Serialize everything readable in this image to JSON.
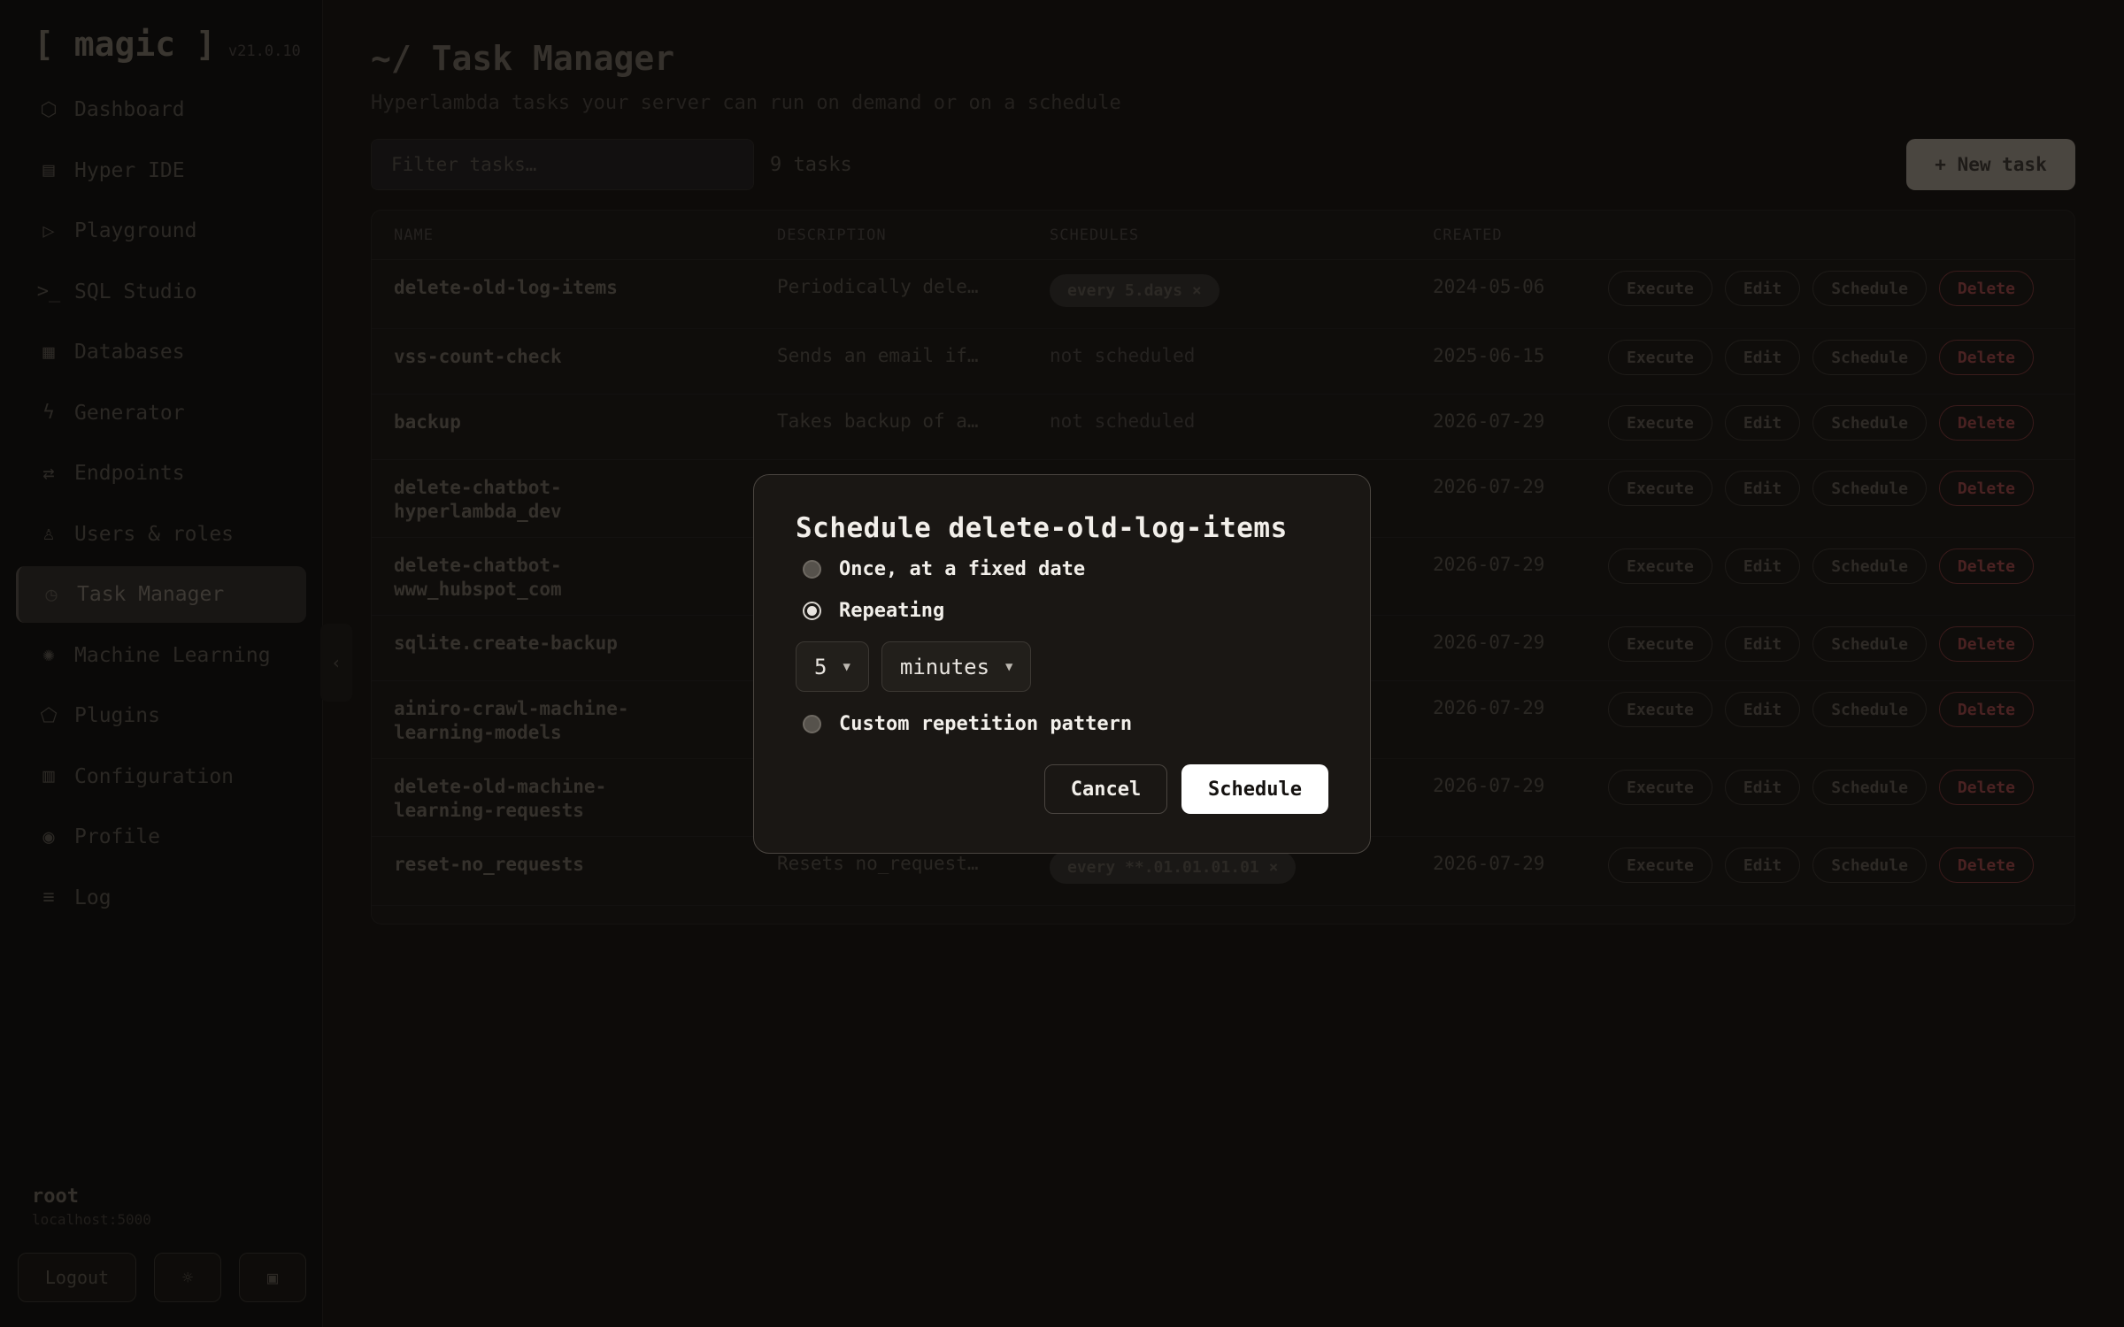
{
  "brand": {
    "logo": "[ magic ]",
    "version": "v21.0.10"
  },
  "nav": [
    {
      "label": "Dashboard",
      "icon": "dashboard-icon",
      "glyph": "⬡"
    },
    {
      "label": "Hyper IDE",
      "icon": "file-icon",
      "glyph": "▤"
    },
    {
      "label": "Playground",
      "icon": "play-icon",
      "glyph": "▷"
    },
    {
      "label": "SQL Studio",
      "icon": "terminal-icon",
      "glyph": ">_"
    },
    {
      "label": "Databases",
      "icon": "database-icon",
      "glyph": "▦"
    },
    {
      "label": "Generator",
      "icon": "bolt-icon",
      "glyph": "ϟ"
    },
    {
      "label": "Endpoints",
      "icon": "endpoints-icon",
      "glyph": "⇄"
    },
    {
      "label": "Users & roles",
      "icon": "user-icon",
      "glyph": "♙"
    },
    {
      "label": "Task Manager",
      "icon": "clock-icon",
      "glyph": "◷",
      "active": true
    },
    {
      "label": "Machine Learning",
      "icon": "brain-icon",
      "glyph": "✺"
    },
    {
      "label": "Plugins",
      "icon": "plugin-icon",
      "glyph": "⬠"
    },
    {
      "label": "Configuration",
      "icon": "config-icon",
      "glyph": "▥"
    },
    {
      "label": "Profile",
      "icon": "profile-icon",
      "glyph": "◉"
    },
    {
      "label": "Log",
      "icon": "log-icon",
      "glyph": "≡"
    }
  ],
  "user": {
    "name": "root",
    "host": "localhost:5000"
  },
  "footer": {
    "logout": "Logout",
    "theme_glyph": "☼",
    "settings_glyph": "▣"
  },
  "page": {
    "title": "~/ Task Manager",
    "subtitle": "Hyperlambda tasks your server can run on demand or on a schedule",
    "filter_placeholder": "Filter tasks…",
    "task_count": "9 tasks",
    "new_task": "+ New task"
  },
  "table": {
    "headers": {
      "name": "NAME",
      "description": "DESCRIPTION",
      "schedules": "SCHEDULES",
      "created": "CREATED"
    },
    "actions": {
      "execute": "Execute",
      "edit": "Edit",
      "schedule": "Schedule",
      "delete": "Delete"
    },
    "rows": [
      {
        "name": "delete-old-log-items",
        "description": "Periodically dele…",
        "schedule": "every 5.days ×",
        "scheduled": true,
        "created": "2024-05-06"
      },
      {
        "name": "vss-count-check",
        "description": "Sends an email if…",
        "schedule": "not scheduled",
        "scheduled": false,
        "created": "2025-06-15"
      },
      {
        "name": "backup",
        "description": "Takes backup of a…",
        "schedule": "not scheduled",
        "scheduled": false,
        "created": "2026-07-29"
      },
      {
        "name": "delete-chatbot-hyperlambda_dev",
        "description": "",
        "schedule": "",
        "scheduled": false,
        "created": "2026-07-29"
      },
      {
        "name": "delete-chatbot-www_hubspot_com",
        "description": "",
        "schedule": "",
        "scheduled": false,
        "created": "2026-07-29"
      },
      {
        "name": "sqlite.create-backup",
        "description": "",
        "schedule": "",
        "scheduled": false,
        "created": "2026-07-29"
      },
      {
        "name": "ainiro-crawl-machine-learning-models",
        "description": "",
        "schedule": "",
        "scheduled": false,
        "created": "2026-07-29"
      },
      {
        "name": "delete-old-machine-learning-requests",
        "description": "",
        "schedule": "",
        "scheduled": false,
        "created": "2026-07-29"
      },
      {
        "name": "reset-no_requests",
        "description": "Resets no_request…",
        "schedule": "every **.01.01.01.01 ×",
        "scheduled": true,
        "created": "2026-07-29"
      }
    ]
  },
  "dialog": {
    "title": "Schedule delete-old-log-items",
    "option_once": "Once, at a fixed date",
    "option_repeating": "Repeating",
    "option_custom": "Custom repetition pattern",
    "selected_option": "repeating",
    "interval_value": "5",
    "interval_unit": "minutes",
    "cancel": "Cancel",
    "schedule": "Schedule"
  }
}
